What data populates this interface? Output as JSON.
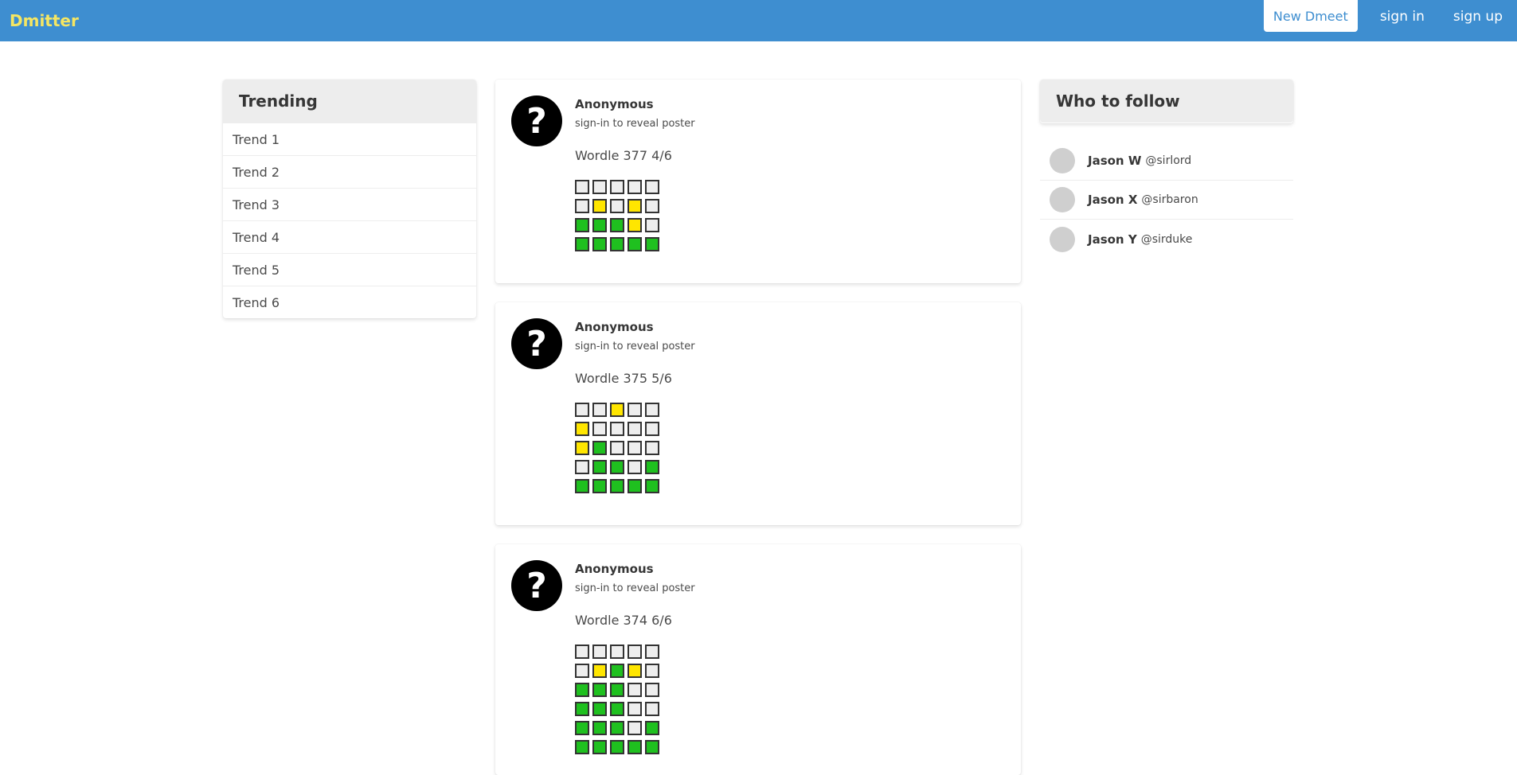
{
  "navbar": {
    "brand": "Dmitter",
    "new_button": "New Dmeet",
    "sign_in": "sign in",
    "sign_up": "sign up",
    "colors": {
      "bar": "#3e8ed0",
      "brand": "#f5e663"
    }
  },
  "trending": {
    "title": "Trending",
    "items": [
      "Trend 1",
      "Trend 2",
      "Trend 3",
      "Trend 4",
      "Trend 5",
      "Trend 6"
    ]
  },
  "who_to_follow": {
    "title": "Who to follow",
    "users": [
      {
        "name": "Jason W",
        "handle": "@sirlord"
      },
      {
        "name": "Jason X",
        "handle": "@sirbaron"
      },
      {
        "name": "Jason Y",
        "handle": "@sirduke"
      }
    ]
  },
  "posts": [
    {
      "author": "Anonymous",
      "subtitle": "sign-in to reveal poster",
      "title": "Wordle 377 4/6",
      "icon": "question-mark-icon",
      "grid": [
        "wwwww",
        "wywyw",
        "gggyw",
        "ggggg"
      ]
    },
    {
      "author": "Anonymous",
      "subtitle": "sign-in to reveal poster",
      "title": "Wordle 375 5/6",
      "icon": "question-mark-icon",
      "grid": [
        "wwyww",
        "ywwww",
        "ygwww",
        "wggwg",
        "ggggg"
      ]
    },
    {
      "author": "Anonymous",
      "subtitle": "sign-in to reveal poster",
      "title": "Wordle 374 6/6",
      "icon": "question-mark-icon",
      "grid": [
        "wwwww",
        "wygyw",
        "gggww",
        "gggww",
        "gggwg",
        "ggggg"
      ]
    }
  ],
  "tile_colors": {
    "w": "#eeeeee",
    "y": "#ffe600",
    "g": "#1fc01f"
  }
}
